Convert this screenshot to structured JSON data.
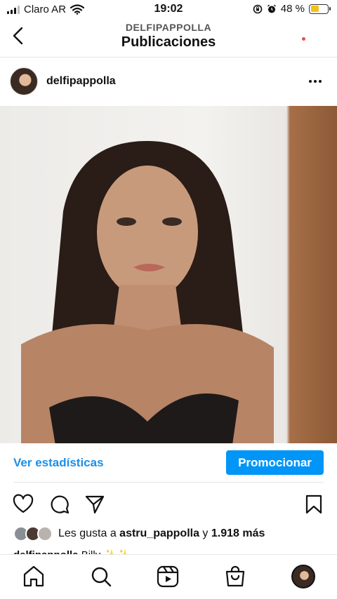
{
  "status_bar": {
    "carrier": "Claro AR",
    "time": "19:02",
    "battery_percent": "48 %",
    "battery_level": 0.48,
    "icons": [
      "signal-icon",
      "wifi-icon",
      "orientation-lock-icon",
      "alarm-icon",
      "battery-icon"
    ]
  },
  "header": {
    "username": "DELFIPAPPOLLA",
    "title": "Publicaciones",
    "back_icon": "chevron-left-icon"
  },
  "post": {
    "username": "delfipappolla",
    "more_icon": "more-icon",
    "image_alt": "photo",
    "view_stats_label": "Ver estadísticas",
    "promote_label": "Promocionar",
    "action_icons": [
      "heart-icon",
      "comment-icon",
      "share-icon",
      "bookmark-icon"
    ],
    "likes_prefix": "Les gusta a ",
    "likes_user": "astru_pappolla",
    "likes_middle": " y ",
    "likes_count": "1.918 más",
    "caption_user": "delfipappolla",
    "caption_text": "Billy ✨✨"
  },
  "tab_bar": {
    "icons": [
      "home-icon",
      "search-icon",
      "reels-icon",
      "shop-icon",
      "profile-avatar"
    ]
  },
  "colors": {
    "accent": "#0095f6",
    "link": "#1d8fe8",
    "battery": "#f2c11c",
    "notification": "#ed4956"
  }
}
